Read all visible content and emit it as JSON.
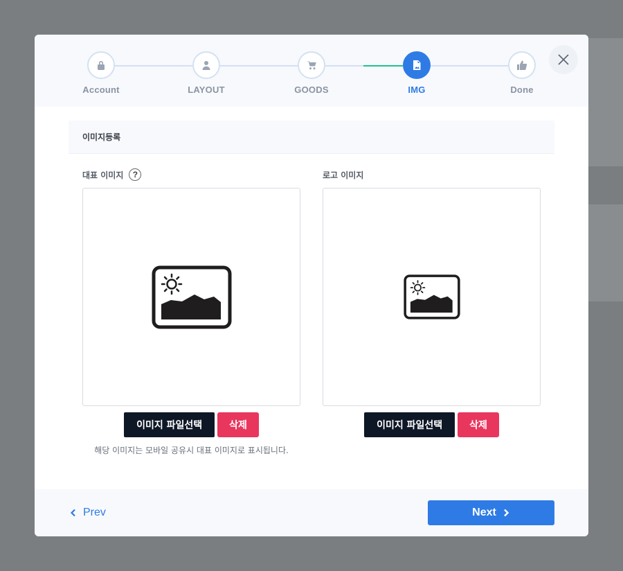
{
  "steps": [
    {
      "label": "Account",
      "icon": "lock-icon",
      "state": "done"
    },
    {
      "label": "LAYOUT",
      "icon": "user-icon",
      "state": "done"
    },
    {
      "label": "GOODS",
      "icon": "cart-icon",
      "state": "done"
    },
    {
      "label": "IMG",
      "icon": "image-file-icon",
      "state": "active"
    },
    {
      "label": "Done",
      "icon": "thumbs-up-icon",
      "state": "pending"
    }
  ],
  "section": {
    "title": "이미지등록"
  },
  "main_image": {
    "label": "대표 이미지",
    "help": "?",
    "file_button": "이미지 파일선택",
    "delete_button": "삭제",
    "hint": "해당 이미지는 모바일 공유시 대표 이미지로 표시됩니다."
  },
  "logo_image": {
    "label": "로고 이미지",
    "file_button": "이미지 파일선택",
    "delete_button": "삭제"
  },
  "footer": {
    "prev": "Prev",
    "next": "Next"
  },
  "colors": {
    "accent": "#2f7be5",
    "complete_line": "#1cc38f",
    "danger": "#e8365d",
    "dark": "#0e1726"
  }
}
